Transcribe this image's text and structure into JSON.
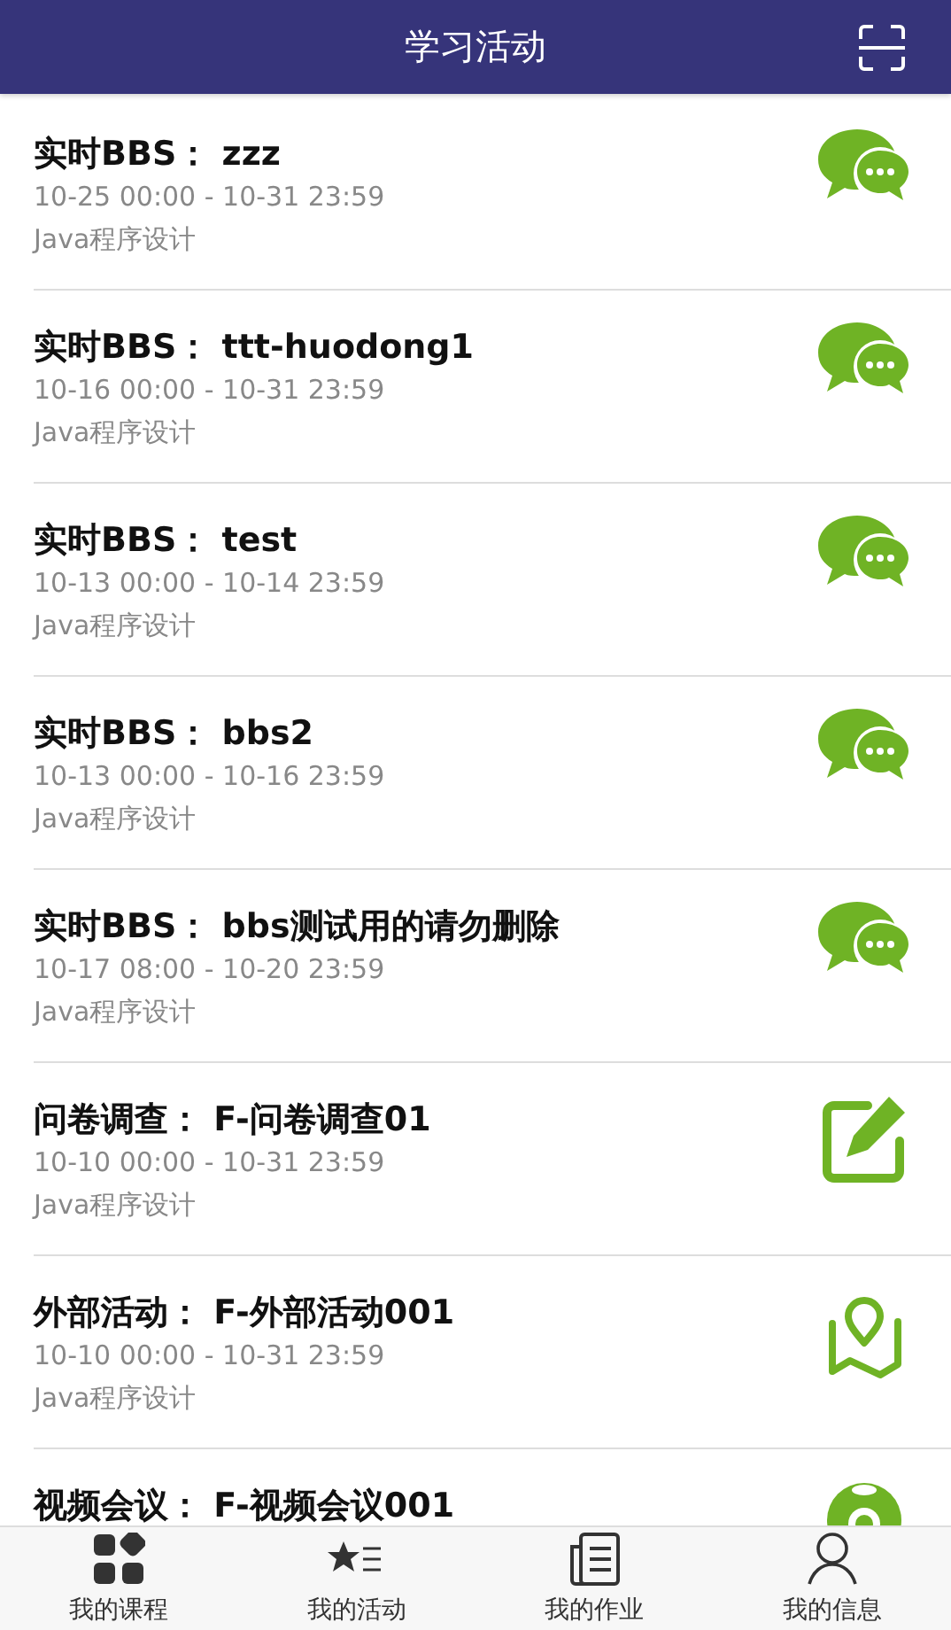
{
  "header": {
    "title": "学习活动"
  },
  "activities": [
    {
      "kind": "bbs",
      "title": "实时BBS： zzz",
      "time": "10-25 00:00 - 10-31 23:59",
      "course": "Java程序设计"
    },
    {
      "kind": "bbs",
      "title": "实时BBS： ttt-huodong1",
      "time": "10-16 00:00 - 10-31 23:59",
      "course": "Java程序设计"
    },
    {
      "kind": "bbs",
      "title": "实时BBS： test",
      "time": "10-13 00:00 - 10-14 23:59",
      "course": "Java程序设计"
    },
    {
      "kind": "bbs",
      "title": "实时BBS： bbs2",
      "time": "10-13 00:00 - 10-16 23:59",
      "course": "Java程序设计"
    },
    {
      "kind": "bbs",
      "title": "实时BBS： bbs测试用的请勿删除",
      "time": "10-17 08:00 - 10-20 23:59",
      "course": "Java程序设计"
    },
    {
      "kind": "survey",
      "title": "问卷调查： F-问卷调查01",
      "time": "10-10 00:00 - 10-31 23:59",
      "course": "Java程序设计"
    },
    {
      "kind": "external",
      "title": "外部活动： F-外部活动001",
      "time": "10-10 00:00 - 10-31 23:59",
      "course": "Java程序设计"
    },
    {
      "kind": "video",
      "title": "视频会议： F-视频会议001"
    }
  ],
  "tabs": [
    {
      "kind": "courses",
      "label": "我的课程",
      "selected": false
    },
    {
      "kind": "activities",
      "label": "我的活动",
      "selected": false
    },
    {
      "kind": "homework",
      "label": "我的作业",
      "selected": false
    },
    {
      "kind": "profile",
      "label": "我的信息",
      "selected": false
    }
  ]
}
